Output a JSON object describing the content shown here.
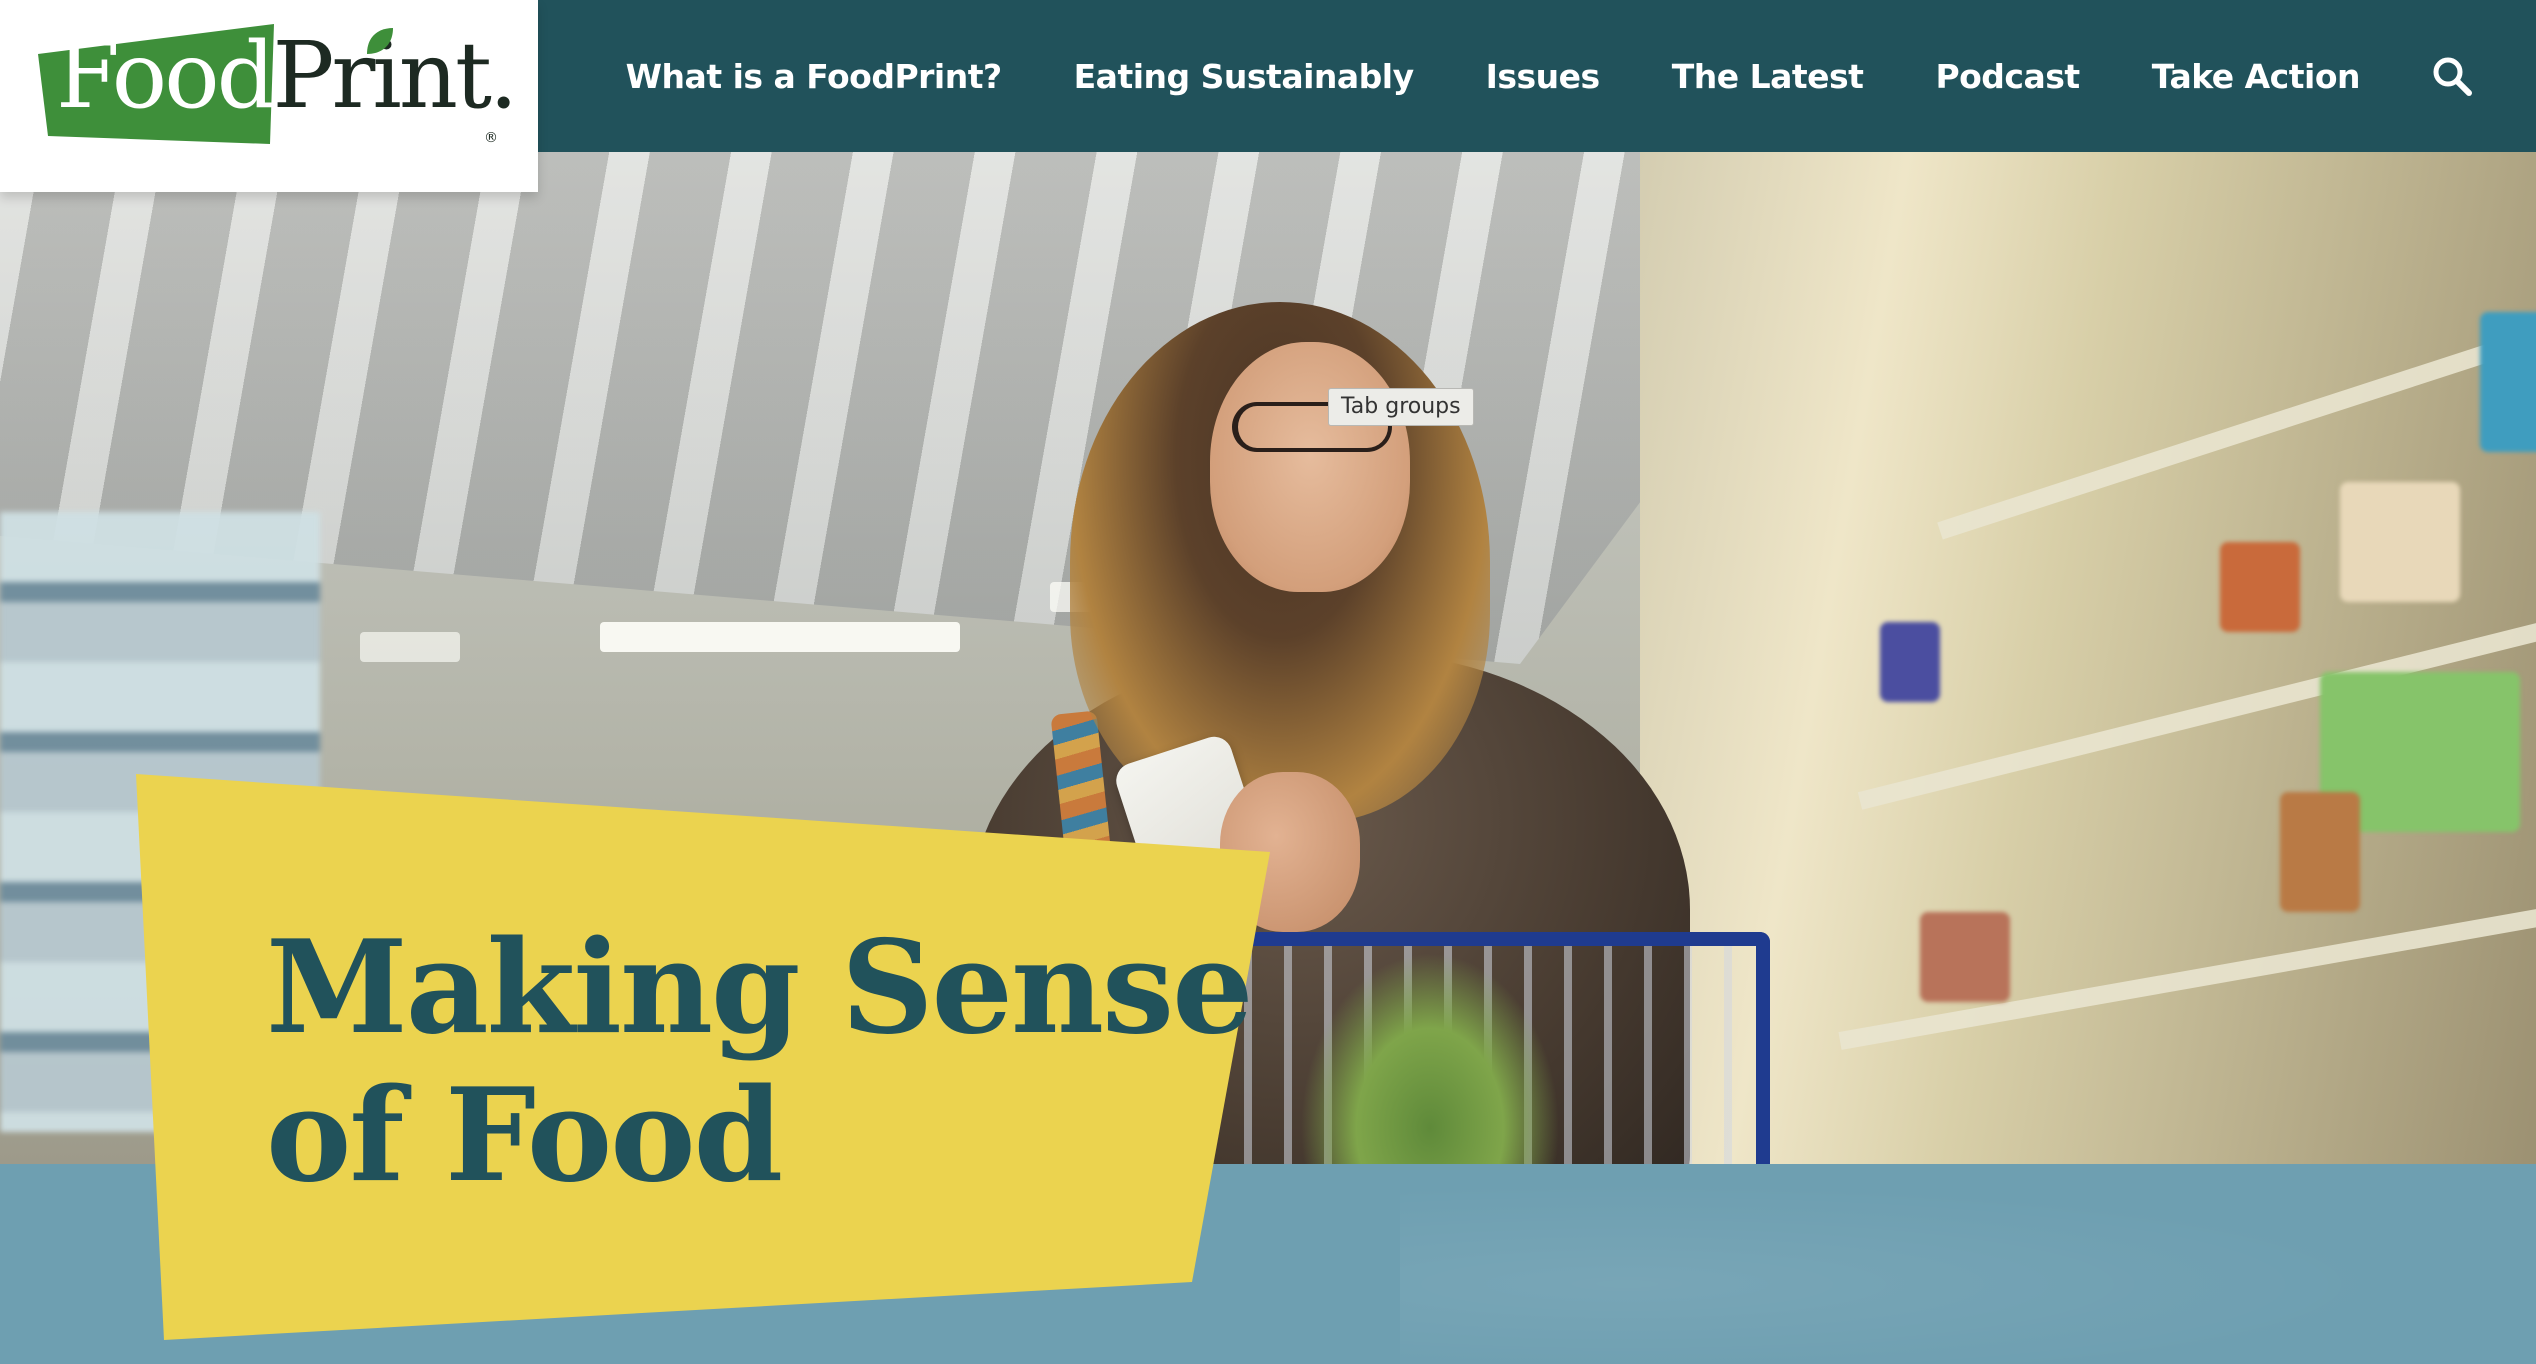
{
  "brand": {
    "name_part1": "Food",
    "name_part2": "Print.",
    "registered_mark": "®"
  },
  "nav": {
    "items": [
      {
        "label": "What is a FoodPrint?"
      },
      {
        "label": "Eating Sustainably"
      },
      {
        "label": "Issues"
      },
      {
        "label": "The Latest"
      },
      {
        "label": "Podcast"
      },
      {
        "label": "Take Action"
      }
    ],
    "search_icon": "search-icon"
  },
  "hero": {
    "title_line1": "Making Sense",
    "title_line2": "of Food"
  },
  "tooltip": {
    "text": "Tab groups"
  },
  "colors": {
    "header_bg": "#21525b",
    "logo_green": "#3e8f3a",
    "hero_panel_yellow": "#ebd34f",
    "title_text": "#21525b",
    "band_blue": "#6e9fb1"
  }
}
